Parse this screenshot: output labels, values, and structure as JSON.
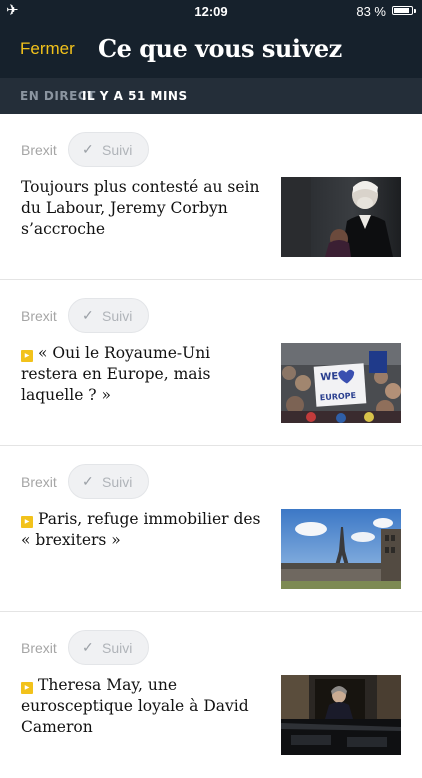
{
  "status_bar": {
    "time": "12:09",
    "battery_text": "83 %",
    "icons": [
      "airplane-icon",
      "battery-icon"
    ]
  },
  "nav": {
    "close_label": "Fermer",
    "title": "Ce que vous suivez"
  },
  "live_bar": {
    "label": "EN DIRECT",
    "time": "IL Y A 51 MINS"
  },
  "colors": {
    "accent": "#f2c21b",
    "header_bg": "#16212c",
    "live_bar_bg": "#242e39"
  },
  "items": [
    {
      "tag": "Brexit",
      "follow_label": "Suivi",
      "live": false,
      "headline": "Toujours plus contesté au sein du Labour, Jeremy Corbyn s’accroche",
      "image_icon": "portrait-photo"
    },
    {
      "tag": "Brexit",
      "follow_label": "Suivi",
      "live": true,
      "headline": "« Oui le Royaume-Uni restera en Europe, mais laquelle ? »",
      "image_icon": "protest-photo",
      "image_text_1": "WE",
      "image_text_2": "EUROPE"
    },
    {
      "tag": "Brexit",
      "follow_label": "Suivi",
      "live": true,
      "headline": "Paris, refuge immobilier des « brexiters »",
      "image_icon": "eiffel-tower-photo"
    },
    {
      "tag": "Brexit",
      "follow_label": "Suivi",
      "live": true,
      "headline": "Theresa May, une eurosceptique loyale à David Cameron",
      "image_icon": "politician-car-photo"
    }
  ]
}
